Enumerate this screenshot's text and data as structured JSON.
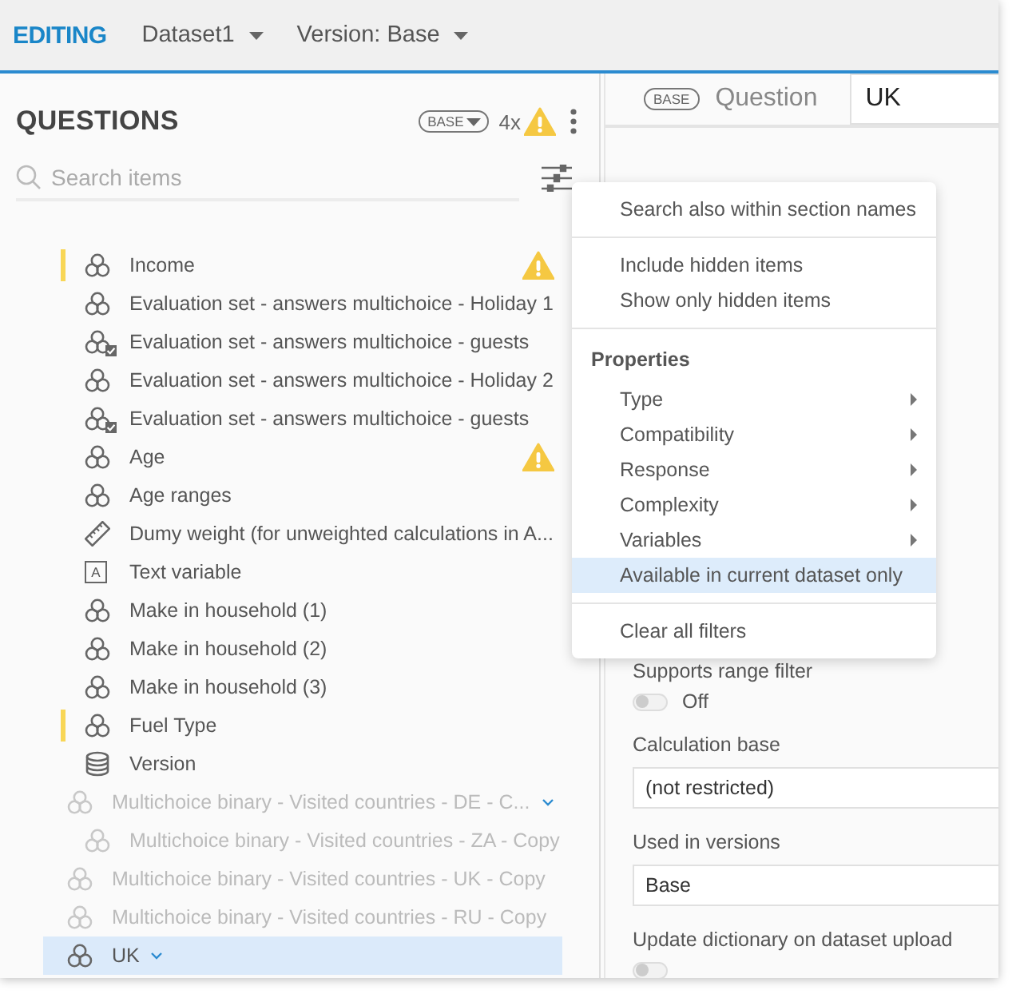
{
  "topbar": {
    "mode": "EDITING",
    "menus": [
      {
        "label": "Dataset1"
      },
      {
        "label": "Version: Base"
      }
    ]
  },
  "questions": {
    "title": "QUESTIONS",
    "version_badge": "BASE",
    "warning_count": "4x",
    "search": {
      "placeholder": "Search items"
    },
    "items": [
      {
        "children": [
          {
            "label": "Income",
            "kind": "multichoice",
            "flagged": true,
            "warning": true,
            "disabled": false,
            "selected": false
          },
          {
            "label": "Evaluation set - answers multichoice - Holiday 1",
            "kind": "multichoice",
            "flagged": false,
            "warning": false,
            "disabled": false,
            "selected": false
          },
          {
            "label": "Evaluation set - answers multichoice - guests",
            "kind": "multichoice-checked",
            "flagged": false,
            "warning": false,
            "disabled": false,
            "selected": false
          },
          {
            "label": "Evaluation set - answers multichoice - Holiday 2",
            "kind": "multichoice",
            "flagged": false,
            "warning": false,
            "disabled": false,
            "selected": false
          },
          {
            "label": "Evaluation set - answers multichoice - guests",
            "kind": "multichoice-checked",
            "flagged": false,
            "warning": false,
            "disabled": false,
            "selected": false
          },
          {
            "label": "Age",
            "kind": "multichoice",
            "flagged": false,
            "warning": true,
            "disabled": false,
            "selected": false
          },
          {
            "label": "Age ranges",
            "kind": "multichoice",
            "flagged": false,
            "warning": false,
            "disabled": false,
            "selected": false
          },
          {
            "label": "Dumy weight (for unweighted calculations in A...",
            "kind": "weight",
            "flagged": false,
            "warning": false,
            "disabled": false,
            "selected": false
          },
          {
            "label": "Text variable",
            "kind": "text",
            "icon_letter": "A",
            "flagged": false,
            "warning": false,
            "disabled": false,
            "selected": false
          },
          {
            "label": "Make in household (1)",
            "kind": "multichoice",
            "flagged": false,
            "warning": false,
            "disabled": false,
            "selected": false
          },
          {
            "label": "Make in household (2)",
            "kind": "multichoice",
            "flagged": false,
            "warning": false,
            "disabled": false,
            "selected": false
          },
          {
            "label": "Make in household (3)",
            "kind": "multichoice",
            "flagged": false,
            "warning": false,
            "disabled": false,
            "selected": false
          },
          {
            "label": "Fuel Type",
            "kind": "multichoice",
            "flagged": true,
            "warning": false,
            "disabled": false,
            "selected": false
          },
          {
            "label": "Version",
            "kind": "database",
            "flagged": false,
            "warning": false,
            "disabled": false,
            "selected": false
          }
        ]
      },
      {
        "label": "Multichoice binary - Visited countries - DE - C...",
        "kind": "multichoice",
        "flagged": false,
        "warning": false,
        "disabled": true,
        "selected": false,
        "expanded": true,
        "children": [
          {
            "label": "Multichoice binary - Visited countries - ZA - Copy",
            "kind": "multichoice",
            "flagged": false,
            "warning": false,
            "disabled": true,
            "selected": false
          }
        ]
      },
      {
        "label": "Multichoice binary - Visited countries - UK - Copy",
        "kind": "multichoice",
        "flagged": false,
        "warning": false,
        "disabled": true,
        "selected": false
      },
      {
        "label": "Multichoice binary - Visited countries - RU - Copy",
        "kind": "multichoice",
        "flagged": false,
        "warning": false,
        "disabled": true,
        "selected": false
      },
      {
        "label": "UK",
        "kind": "multichoice",
        "flagged": false,
        "warning": false,
        "disabled": false,
        "selected": true,
        "expanded": true
      }
    ]
  },
  "detail": {
    "badge": "BASE",
    "label": "Question",
    "value": "UK",
    "fields": [
      {
        "kind": "toggle",
        "label": "Supports range filter",
        "on": false,
        "state_text": "Off"
      },
      {
        "kind": "select",
        "label": "Calculation base",
        "value": "(not restricted)"
      },
      {
        "kind": "select",
        "label": "Used in versions",
        "value": "Base"
      },
      {
        "kind": "toggle",
        "label": "Update dictionary on dataset upload",
        "on": false
      }
    ]
  },
  "filter_menu": {
    "sections": [
      {
        "items": [
          {
            "label": "Search also within section names",
            "submenu": false,
            "highlighted": false
          }
        ]
      },
      {
        "items": [
          {
            "label": "Include hidden items",
            "submenu": false,
            "highlighted": false
          },
          {
            "label": "Show only hidden items",
            "submenu": false,
            "highlighted": false
          }
        ]
      },
      {
        "heading": "Properties",
        "items": [
          {
            "label": "Type",
            "submenu": true,
            "highlighted": false
          },
          {
            "label": "Compatibility",
            "submenu": true,
            "highlighted": false
          },
          {
            "label": "Response",
            "submenu": true,
            "highlighted": false
          },
          {
            "label": "Complexity",
            "submenu": true,
            "highlighted": false
          },
          {
            "label": "Variables",
            "submenu": true,
            "highlighted": false
          },
          {
            "label": "Available in current dataset only",
            "submenu": false,
            "highlighted": true
          }
        ]
      },
      {
        "items": [
          {
            "label": "Clear all filters",
            "submenu": false,
            "highlighted": false
          }
        ]
      }
    ]
  }
}
